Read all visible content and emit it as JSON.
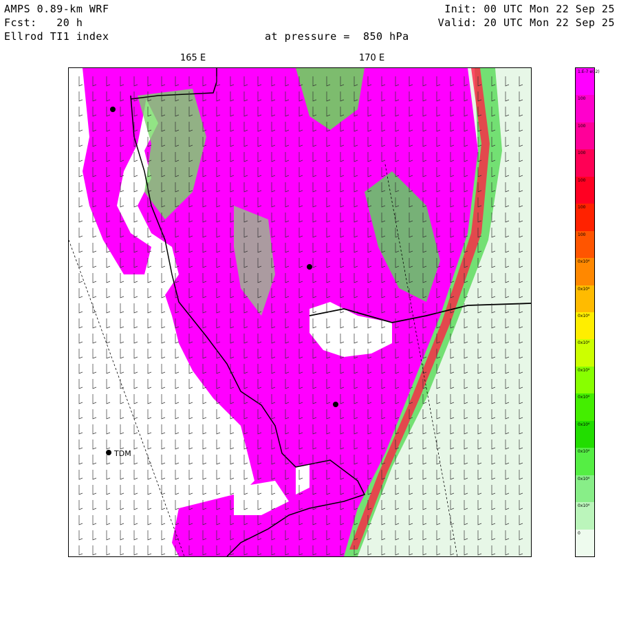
{
  "header": {
    "model": "AMPS 0.89-km WRF",
    "forecast_label": "Fcst:",
    "forecast_hours": "20 h",
    "field": "Ellrod TI1 index",
    "pressure_label": "at pressure =",
    "pressure_value": "850 hPa",
    "init": "Init: 00 UTC Mon 22 Sep 25",
    "valid": "Valid: 20 UTC Mon 22 Sep 25"
  },
  "map": {
    "longitude_labels": [
      "165 E",
      "170 E"
    ],
    "stations": [
      {
        "id": "TDM",
        "label": "TDM"
      },
      {
        "id": "st1",
        "label": ""
      },
      {
        "id": "st2",
        "label": ""
      },
      {
        "id": "st3",
        "label": ""
      }
    ]
  },
  "colorbar": {
    "labels": [
      "1.E-7 e(-2)",
      "100",
      "100",
      "100",
      "100",
      "100",
      "100",
      "0x10⁶",
      "0x10⁶",
      "0x10⁶",
      "0x10⁶",
      "0x10⁶",
      "0x10⁶",
      "0x10⁶",
      "0x10⁶",
      "0x10⁶",
      "0x10⁶",
      "0"
    ],
    "colors": [
      "#ff00ff",
      "#ff00cc",
      "#ff0099",
      "#ff0055",
      "#ff0022",
      "#ff2200",
      "#ff5500",
      "#ff8800",
      "#ffbb00",
      "#ffee00",
      "#ccff00",
      "#88ff00",
      "#44ee00",
      "#22dd00",
      "#55ee44",
      "#88ee88",
      "#bbf5bb",
      "#eefbee"
    ]
  }
}
